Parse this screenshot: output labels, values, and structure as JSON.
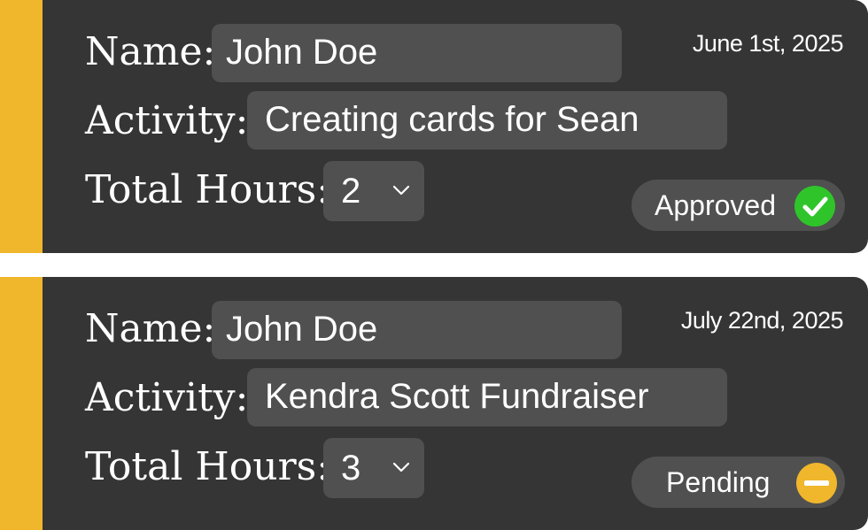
{
  "labels": {
    "name": "Name:",
    "activity": "Activity:",
    "hours": "Total Hours:"
  },
  "colors": {
    "accent": "#f0b62c",
    "card": "#353535",
    "field": "#505050",
    "approved": "#2fc52a",
    "pending": "#f0b62c"
  },
  "entries": [
    {
      "name": "John Doe",
      "activity": "Creating cards for Sean",
      "hours": "2",
      "date": "June 1st, 2025",
      "status": "Approved",
      "status_icon": "check-circle-icon"
    },
    {
      "name": "John Doe",
      "activity": "Kendra Scott Fundraiser",
      "hours": "3",
      "date": "July 22nd, 2025",
      "status": "Pending",
      "status_icon": "minus-circle-icon"
    }
  ]
}
